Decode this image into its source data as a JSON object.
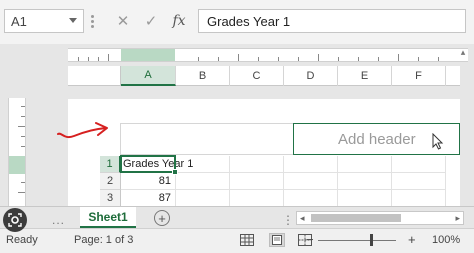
{
  "formula_bar": {
    "name_box": "A1",
    "cancel_symbol": "✕",
    "enter_symbol": "✓",
    "fx_label": "fx",
    "formula": "Grades Year 1"
  },
  "columns": [
    "A",
    "B",
    "C",
    "D",
    "E",
    "F"
  ],
  "selected_column": "A",
  "header": {
    "placeholder": "Add header"
  },
  "rows": [
    {
      "number": "1",
      "cells": [
        "Grades Year 1",
        "",
        "",
        "",
        "",
        ""
      ]
    },
    {
      "number": "2",
      "cells": [
        "81",
        "",
        "",
        "",
        "",
        ""
      ]
    },
    {
      "number": "3",
      "cells": [
        "87",
        "",
        "",
        "",
        "",
        ""
      ]
    }
  ],
  "sheets": {
    "overflow": "...",
    "active": "Sheet1",
    "add_symbol": "+"
  },
  "status_bar": {
    "ready": "Ready",
    "page": "Page: 1 of 3",
    "zoom_minus": "−",
    "zoom_plus": "+",
    "zoom": "100%",
    "zoom_level": 1.0
  },
  "colors": {
    "accent": "#217346",
    "annotation_arrow": "#d62020"
  },
  "icons": [
    "normal-view-icon",
    "page-layout-view-icon",
    "page-break-preview-icon",
    "lens-icon",
    "mouse-cursor-icon"
  ]
}
